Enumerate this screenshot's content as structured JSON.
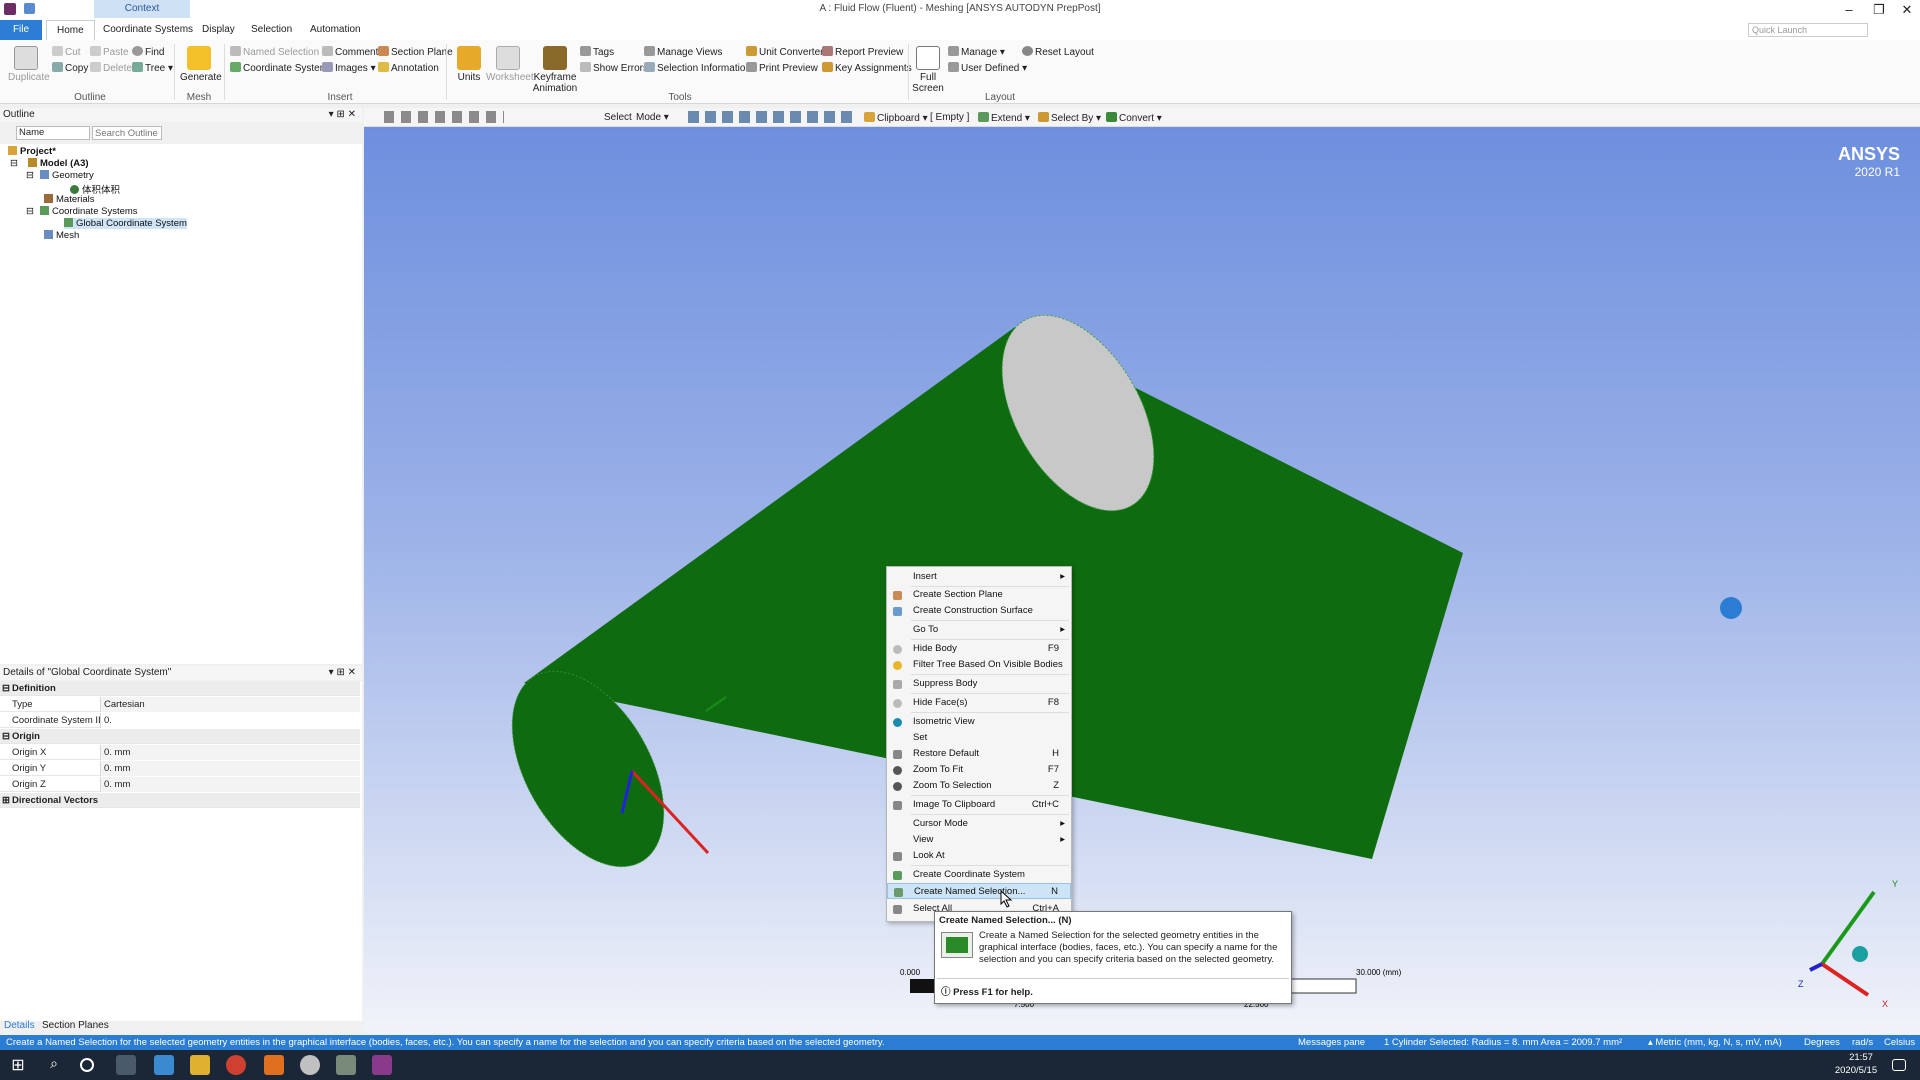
{
  "window": {
    "title": "A : Fluid Flow (Fluent) - Meshing [ANSYS AUTODYN PrepPost]",
    "context_tab": "Context",
    "quick_launch": "Quick Launch"
  },
  "tabs": [
    "File",
    "Home",
    "Coordinate Systems",
    "Display",
    "Selection",
    "Automation"
  ],
  "ribbon": {
    "duplicate": "Duplicate",
    "cut": "Cut",
    "copy": "Copy",
    "paste": "Paste",
    "delete": "Delete",
    "find": "Find",
    "tree": "Tree",
    "generate": "Generate",
    "named_selection": "Named Selection",
    "coordinate_system": "Coordinate System",
    "comment": "Comment",
    "images": "Images",
    "section_plane": "Section Plane",
    "annotation": "Annotation",
    "units": "Units",
    "worksheet": "Worksheet",
    "keyframe": "Keyframe Animation",
    "tags": "Tags",
    "show_errors": "Show Errors",
    "manage_views": "Manage Views",
    "selection_info": "Selection Information",
    "unit_converter": "Unit Converter",
    "print_preview": "Print Preview",
    "report_preview": "Report Preview",
    "key_assignments": "Key Assignments",
    "full_screen": "Full Screen",
    "manage": "Manage",
    "user_defined": "User Defined",
    "reset_layout": "Reset Layout",
    "groups": {
      "outline": "Outline",
      "mesh": "Mesh",
      "insert": "Insert",
      "tools": "Tools",
      "layout": "Layout"
    }
  },
  "outline": {
    "title": "Outline",
    "name_filter": "Name",
    "search_placeholder": "Search Outline",
    "tree": [
      "Project*",
      "Model (A3)",
      "Geometry",
      "体积体积",
      "Materials",
      "Coordinate Systems",
      "Global Coordinate System",
      "Mesh"
    ]
  },
  "details": {
    "title": "Details of \"Global Coordinate System\"",
    "sections": {
      "definition": "Definition",
      "origin": "Origin",
      "directional": "Directional Vectors"
    },
    "rows": {
      "type_k": "Type",
      "type_v": "Cartesian",
      "csid_k": "Coordinate System ID",
      "csid_v": "0.",
      "ox_k": "Origin X",
      "ox_v": "0. mm",
      "oy_k": "Origin Y",
      "oy_v": "0. mm",
      "oz_k": "Origin Z",
      "oz_v": "0. mm"
    },
    "tabs": [
      "Details",
      "Section Planes"
    ]
  },
  "viewport_toolbar": {
    "select": "Select",
    "mode": "Mode",
    "clipboard": "Clipboard",
    "empty": "[ Empty ]",
    "extend": "Extend",
    "select_by": "Select By",
    "convert": "Convert"
  },
  "brand": {
    "name": "ANSYS",
    "version": "2020 R1"
  },
  "scale": {
    "l0": "0.000",
    "l1": "7.500",
    "l2": "22.500",
    "l3": "30.000 (mm)"
  },
  "triad": {
    "x": "X",
    "y": "Y",
    "z": "Z"
  },
  "context_menu": [
    {
      "label": "Insert",
      "shortcut": "",
      "sub": true
    },
    {
      "label": "Create Section Plane",
      "shortcut": "",
      "sub": false
    },
    {
      "label": "Create Construction Surface",
      "shortcut": "",
      "sub": false
    },
    {
      "label": "Go To",
      "shortcut": "",
      "sub": true
    },
    {
      "label": "Hide Body",
      "shortcut": "F9",
      "sub": false
    },
    {
      "label": "Filter Tree Based On Visible Bodies",
      "shortcut": "",
      "sub": false
    },
    {
      "label": "Suppress Body",
      "shortcut": "",
      "sub": false
    },
    {
      "label": "Hide Face(s)",
      "shortcut": "F8",
      "sub": false
    },
    {
      "label": "Isometric View",
      "shortcut": "",
      "sub": false
    },
    {
      "label": "Set",
      "shortcut": "",
      "sub": false
    },
    {
      "label": "Restore Default",
      "shortcut": "H",
      "sub": false
    },
    {
      "label": "Zoom To Fit",
      "shortcut": "F7",
      "sub": false
    },
    {
      "label": "Zoom To Selection",
      "shortcut": "Z",
      "sub": false
    },
    {
      "label": "Image To Clipboard",
      "shortcut": "Ctrl+C",
      "sub": false
    },
    {
      "label": "Cursor Mode",
      "shortcut": "",
      "sub": true
    },
    {
      "label": "View",
      "shortcut": "",
      "sub": true
    },
    {
      "label": "Look At",
      "shortcut": "",
      "sub": false
    },
    {
      "label": "Create Coordinate System",
      "shortcut": "",
      "sub": false
    },
    {
      "label": "Create Named Selection...",
      "shortcut": "N",
      "sub": false
    },
    {
      "label": "Select All",
      "shortcut": "Ctrl+A",
      "sub": false
    }
  ],
  "tooltip": {
    "title": "Create Named Selection... (N)",
    "body": "Create a Named Selection for the selected geometry entities in the graphical interface (bodies, faces, etc.). You can specify a name for the selection and you can specify criteria based on the selected geometry.",
    "help": "Press F1 for help."
  },
  "status": {
    "message": "Create a Named Selection for the selected geometry entities in the graphical interface (bodies, faces, etc.). You can specify a name for the selection and you can specify criteria based on the selected geometry.",
    "messages_pane": "Messages pane",
    "selection": "1 Cylinder Selected: Radius = 8. mm  Area = 2009.7 mm²",
    "units": "Metric (mm, kg, N, s, mV, mA)",
    "angle": "Degrees",
    "rate": "rad/s",
    "temp": "Celsius"
  },
  "taskbar": {
    "time": "21:57",
    "date": "2020/5/15"
  },
  "colors": {
    "accent": "#2b7cd3",
    "body": "#0f6b0f",
    "face": "#c8c8c8"
  }
}
